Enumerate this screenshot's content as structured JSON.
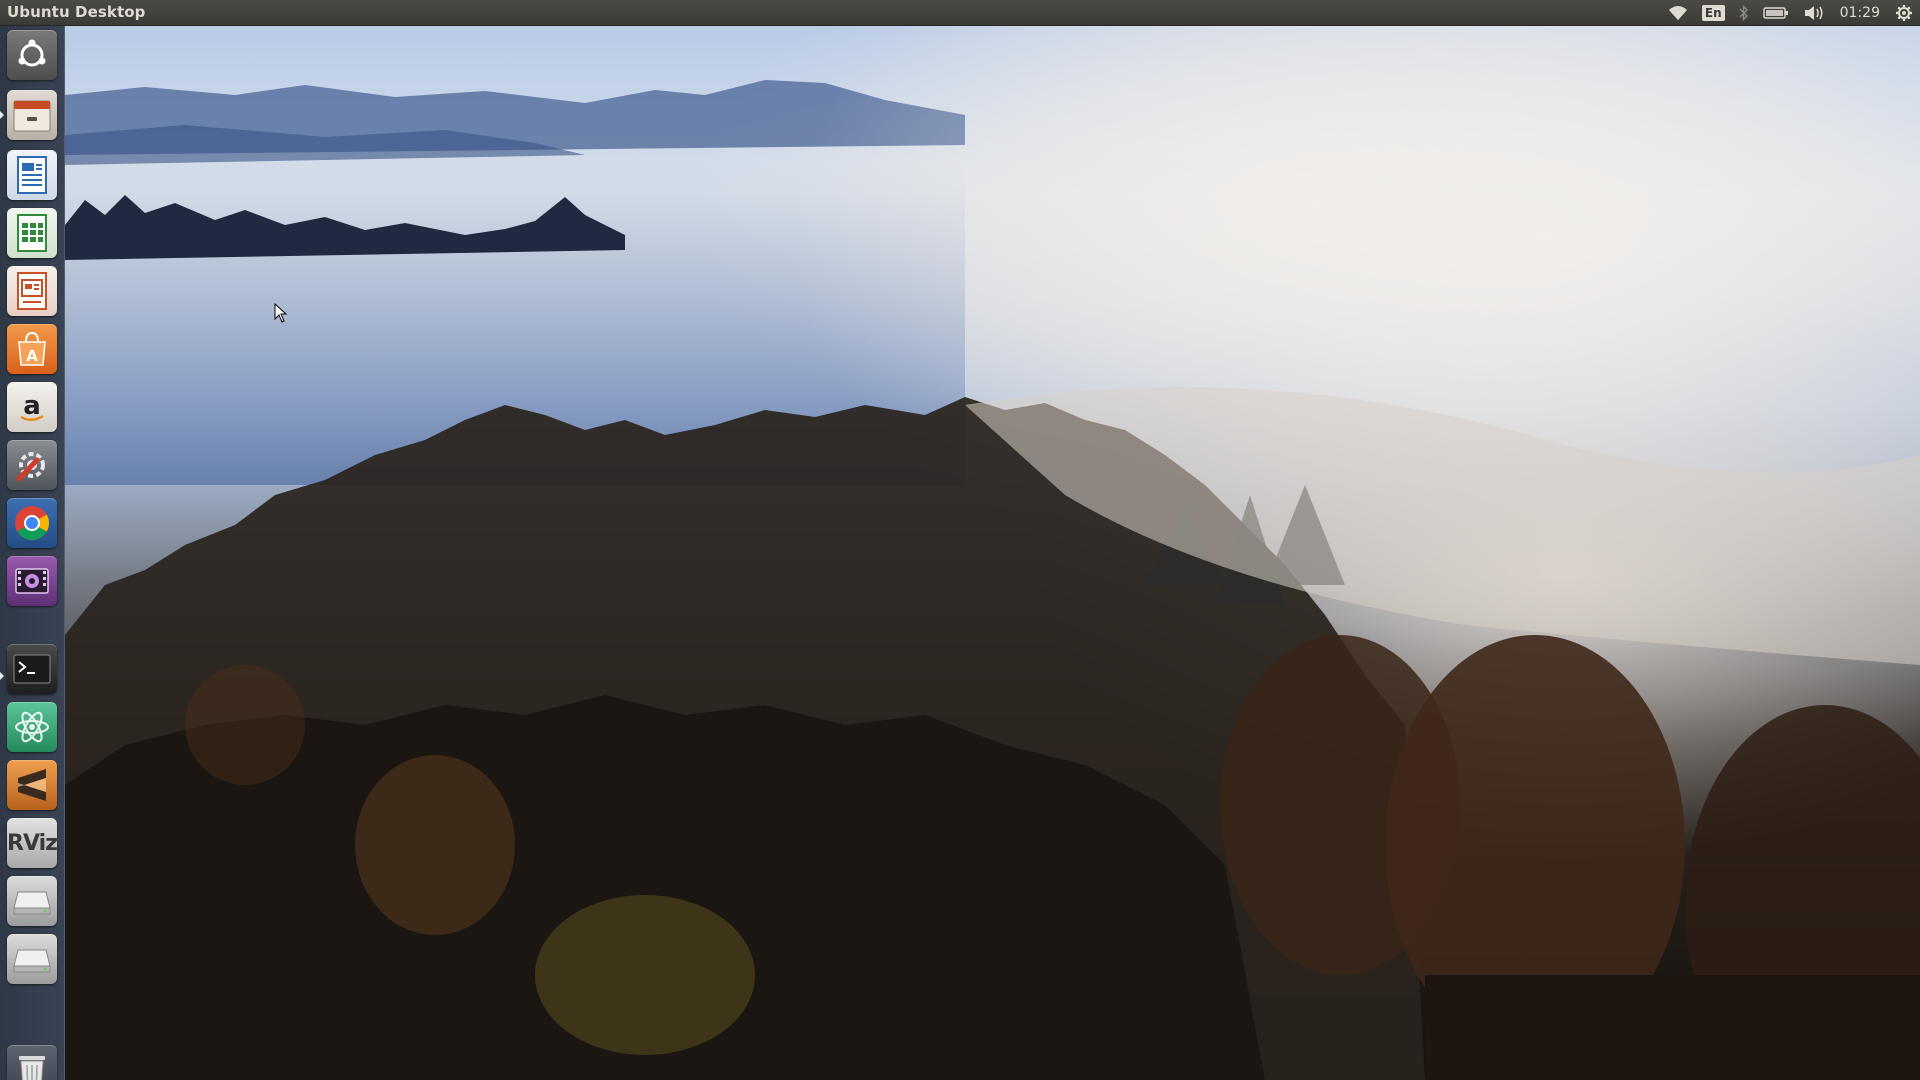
{
  "panel": {
    "title": "Ubuntu Desktop",
    "keyboard_layout": "En",
    "clock": "01:29",
    "indicators": [
      "wifi-icon",
      "keyboard-layout",
      "bluetooth-icon",
      "battery-icon",
      "volume-icon",
      "clock",
      "session-gear-icon"
    ]
  },
  "launcher": {
    "items": [
      {
        "name": "ubuntu-dash",
        "icon": "ubuntu-logo-icon",
        "color": "#6b6b6b"
      },
      {
        "name": "files",
        "icon": "file-cabinet-icon",
        "color": "#d9d4cc",
        "running": true
      },
      {
        "name": "libreoffice-writer",
        "icon": "writer-document-icon",
        "color": "#2a6bb3"
      },
      {
        "name": "libreoffice-calc",
        "icon": "calc-spreadsheet-icon",
        "color": "#2f8a3c"
      },
      {
        "name": "libreoffice-impress",
        "icon": "impress-presentation-icon",
        "color": "#c94f24"
      },
      {
        "name": "ubuntu-software",
        "icon": "shopping-bag-icon",
        "color": "#e8762a"
      },
      {
        "name": "amazon",
        "icon": "amazon-a-icon",
        "color": "#e9e6e0"
      },
      {
        "name": "system-settings",
        "icon": "wrench-gear-icon",
        "color": "#6a6d73"
      },
      {
        "name": "chrome",
        "icon": "chrome-icon",
        "color": "#2f5e9c"
      },
      {
        "name": "video-player",
        "icon": "film-camera-icon",
        "color": "#7a3f8c"
      },
      {
        "name": "terminal",
        "icon": "terminal-prompt-icon",
        "color": "#3a3a3a",
        "running": true
      },
      {
        "name": "atom",
        "icon": "atom-icon",
        "color": "#3daa7a"
      },
      {
        "name": "sublime-text",
        "icon": "sublime-s-icon",
        "color": "#e28a2d"
      },
      {
        "name": "rviz",
        "icon": "rviz-text-icon",
        "color": "#c9c9c9",
        "label": "RViz"
      },
      {
        "name": "drive-1",
        "icon": "hard-drive-icon",
        "color": "#c8c8c8"
      },
      {
        "name": "drive-2",
        "icon": "hard-drive-icon",
        "color": "#c8c8c8"
      },
      {
        "name": "trash",
        "icon": "trash-icon",
        "color": "#b8b8b8"
      }
    ]
  },
  "colors": {
    "panel": "#3b3a36",
    "launcher": "#343d4c",
    "accent": "#e95420"
  }
}
